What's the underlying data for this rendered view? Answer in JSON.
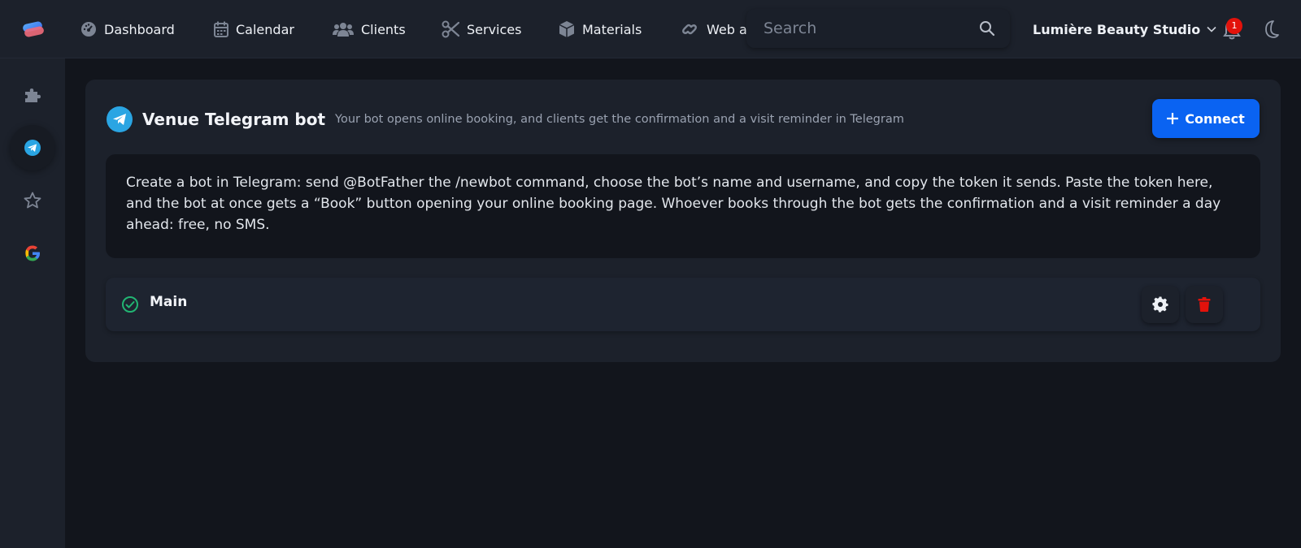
{
  "nav": {
    "items": [
      {
        "label": "Dashboard",
        "icon": "dashboard-gauge-icon"
      },
      {
        "label": "Calendar",
        "icon": "calendar-icon"
      },
      {
        "label": "Clients",
        "icon": "users-icon"
      },
      {
        "label": "Services",
        "icon": "scissors-icon"
      },
      {
        "label": "Materials",
        "icon": "box-icon"
      },
      {
        "label": "Web a",
        "icon": "link-icon"
      }
    ]
  },
  "search": {
    "placeholder": "Search"
  },
  "studio": {
    "name": "Lumière Beauty Studio"
  },
  "notifications": {
    "count": "1"
  },
  "sidebar": {
    "items": [
      {
        "icon": "puzzle-icon",
        "active": false
      },
      {
        "icon": "telegram-icon",
        "active": true
      },
      {
        "icon": "star-icon",
        "active": false
      },
      {
        "icon": "google-icon",
        "active": false
      }
    ]
  },
  "card": {
    "title": "Venue Telegram bot",
    "subtitle": "Your bot opens online booking, and clients get the confirmation and a visit reminder in Telegram",
    "connect_label": "Connect",
    "info": "Create a bot in Telegram: send @BotFather the /newbot command, choose the bot’s name and username, and copy the token it sends. Paste the token here, and the bot at once gets a “Book” button opening your online booking page. Whoever books through the bot gets the confirmation and a visit reminder a day ahead: free, no SMS.",
    "bots": [
      {
        "name": "Main",
        "status": "connected"
      }
    ]
  },
  "colors": {
    "accent": "#0a63f2",
    "telegram": "#2aa5e3",
    "success": "#22b573",
    "danger": "#e3120b",
    "background": "#12151c",
    "panel": "#1c212b"
  }
}
